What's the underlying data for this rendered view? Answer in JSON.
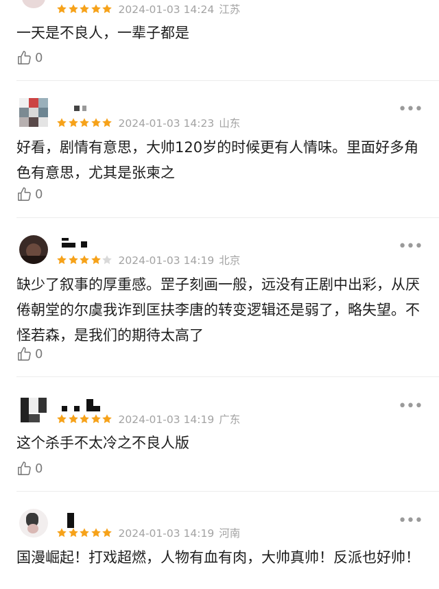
{
  "colors": {
    "star_filled": "#f6a21a",
    "star_empty": "#d9d9d9",
    "meta_text": "#a3a3a3"
  },
  "reviews": [
    {
      "rating": 5,
      "date": "2024-01-03 14:24",
      "location": "江苏",
      "text": "一天是不良人，一辈子都是",
      "likes": "0"
    },
    {
      "rating": 5,
      "date": "2024-01-03 14:23",
      "location": "山东",
      "text": "好看，剧情有意思，大帅120岁的时候更有人情味。里面好多角色有意思，尤其是张柬之",
      "likes": "0"
    },
    {
      "rating": 4,
      "date": "2024-01-03 14:19",
      "location": "北京",
      "text": "缺少了叙事的厚重感。罡子刻画一般，远没有正剧中出彩，从厌倦朝堂的尔虞我诈到匡扶李唐的转变逻辑还是弱了，略失望。不怪若森，是我们的期待太高了",
      "likes": "0"
    },
    {
      "rating": 5,
      "date": "2024-01-03 14:19",
      "location": "广东",
      "text": "这个杀手不太冷之不良人版",
      "likes": "0"
    },
    {
      "rating": 5,
      "date": "2024-01-03 14:19",
      "location": "河南",
      "text": "国漫崛起！打戏超燃，人物有血有肉，大帅真帅！反派也好帅！",
      "likes": null
    }
  ]
}
